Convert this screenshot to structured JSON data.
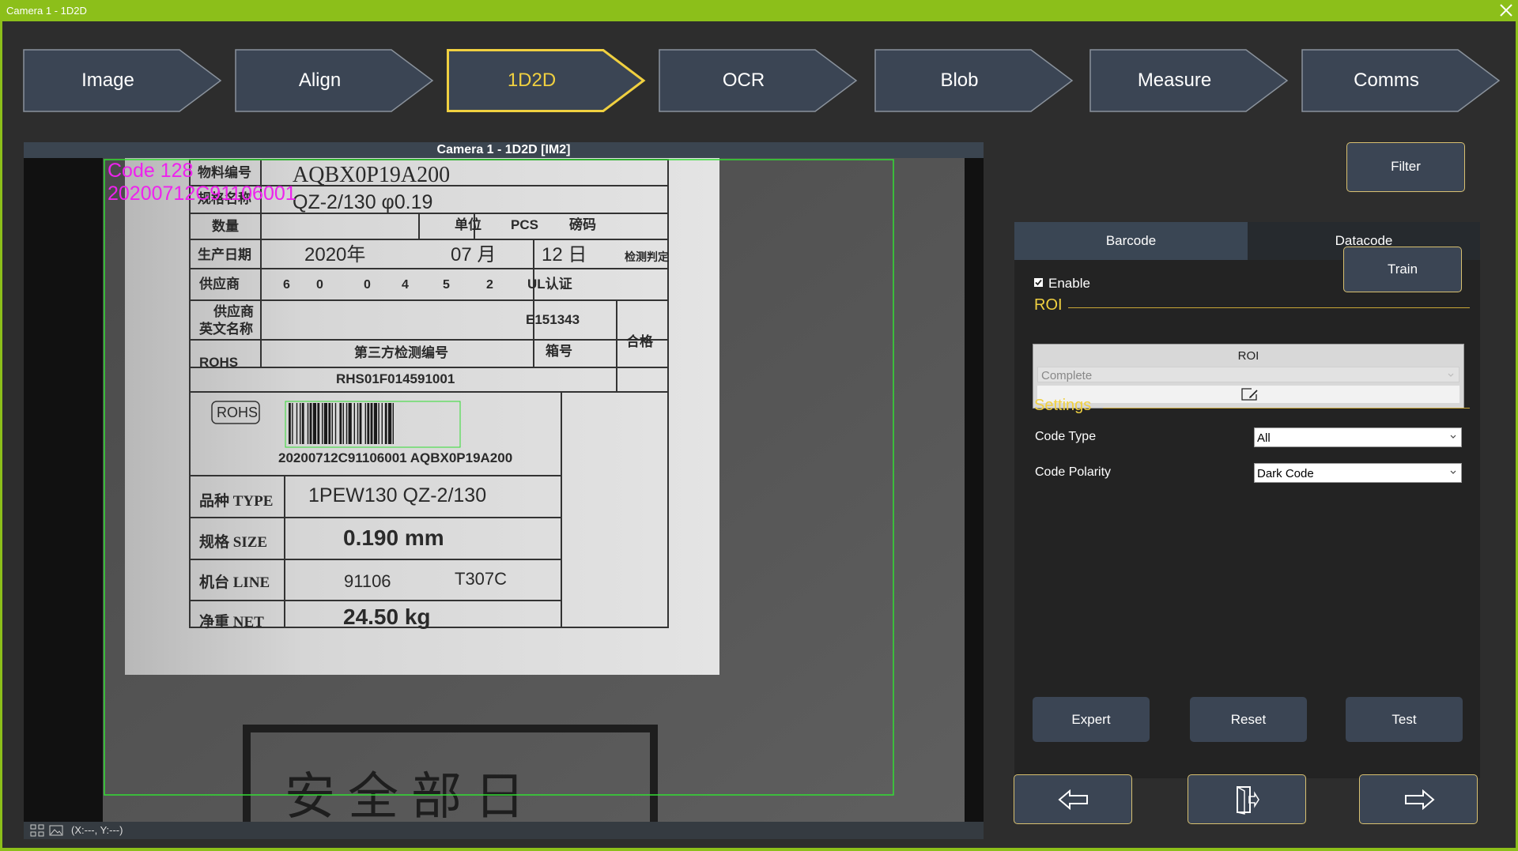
{
  "window": {
    "title": "Camera 1 - 1D2D"
  },
  "workflow": {
    "steps": [
      {
        "label": "Image"
      },
      {
        "label": "Align"
      },
      {
        "label": "1D2D"
      },
      {
        "label": "OCR"
      },
      {
        "label": "Blob"
      },
      {
        "label": "Measure"
      },
      {
        "label": "Comms"
      }
    ],
    "active_step": "1D2D"
  },
  "viewer": {
    "title": "Camera 1 - 1D2D  [IM2]",
    "result": {
      "code_type": "Code 128",
      "decoded": "20200712C91106001"
    },
    "coords": "(X:---, Y:---)",
    "label": {
      "row_material_no": "物料编号",
      "material_no": "AQBX0P19A200",
      "row_spec_name": "规格名称",
      "spec": "QZ-2/130 φ0.19",
      "row_qty": "数量",
      "unit_label": "单位",
      "unit": "PCS",
      "pound_label": "磅码",
      "row_date": "生产日期",
      "year": "2020年",
      "month": "07 月",
      "day": "12 日",
      "inspect_label": "检测判定",
      "row_supplier": "供应商",
      "supplier_digits": [
        "6",
        "0",
        "0",
        "4",
        "5",
        "2"
      ],
      "ul_cert": "UL认证",
      "row_supplier_en_1": "供应商",
      "row_supplier_en_2": "英文名称",
      "ul_no": "E151343",
      "pass_label": "合格",
      "rohs_label": "ROHS",
      "third_party_label": "第三方检测编号",
      "box_no_label": "箱号",
      "rohs_no": "RHS01F014591001",
      "rohs_tag": "ROHS",
      "barcode_text": "20200712C91106001 AQBX0P19A200",
      "type_label": "品种 TYPE",
      "type_value": "1PEW130  QZ-2/130",
      "size_label": "规格 SIZE",
      "size_value": "0.190   mm",
      "line_label": "机台 LINE",
      "line_value_1": "91106",
      "line_value_2": "T307C",
      "net_label": "净重 NET",
      "net_value": "24.50  kg",
      "stamp_text": "安 全 部 日"
    }
  },
  "panel": {
    "filter_label": "Filter",
    "tabs": [
      {
        "label": "Barcode"
      },
      {
        "label": "Datacode"
      }
    ],
    "active_tab": "Barcode",
    "enable": {
      "label": "Enable",
      "checked": true
    },
    "train_label": "Train",
    "roi_section": "ROI",
    "roi": {
      "title": "ROI",
      "mode": "Complete"
    },
    "settings_section": "Settings",
    "code_type": {
      "label": "Code Type",
      "value": "All"
    },
    "code_polarity": {
      "label": "Code Polarity",
      "value": "Dark Code"
    },
    "buttons": {
      "expert": "Expert",
      "reset": "Reset",
      "test": "Test"
    }
  },
  "navigation": {
    "icons": [
      "arrow-left-icon",
      "exit-door-icon",
      "arrow-right-icon"
    ]
  },
  "colors": {
    "accent_green": "#8cbf1a",
    "accent_gold": "#f0d040",
    "button_bg": "#3b4554",
    "result_magenta": "#ee22ee",
    "roi_green": "#33dd33"
  }
}
